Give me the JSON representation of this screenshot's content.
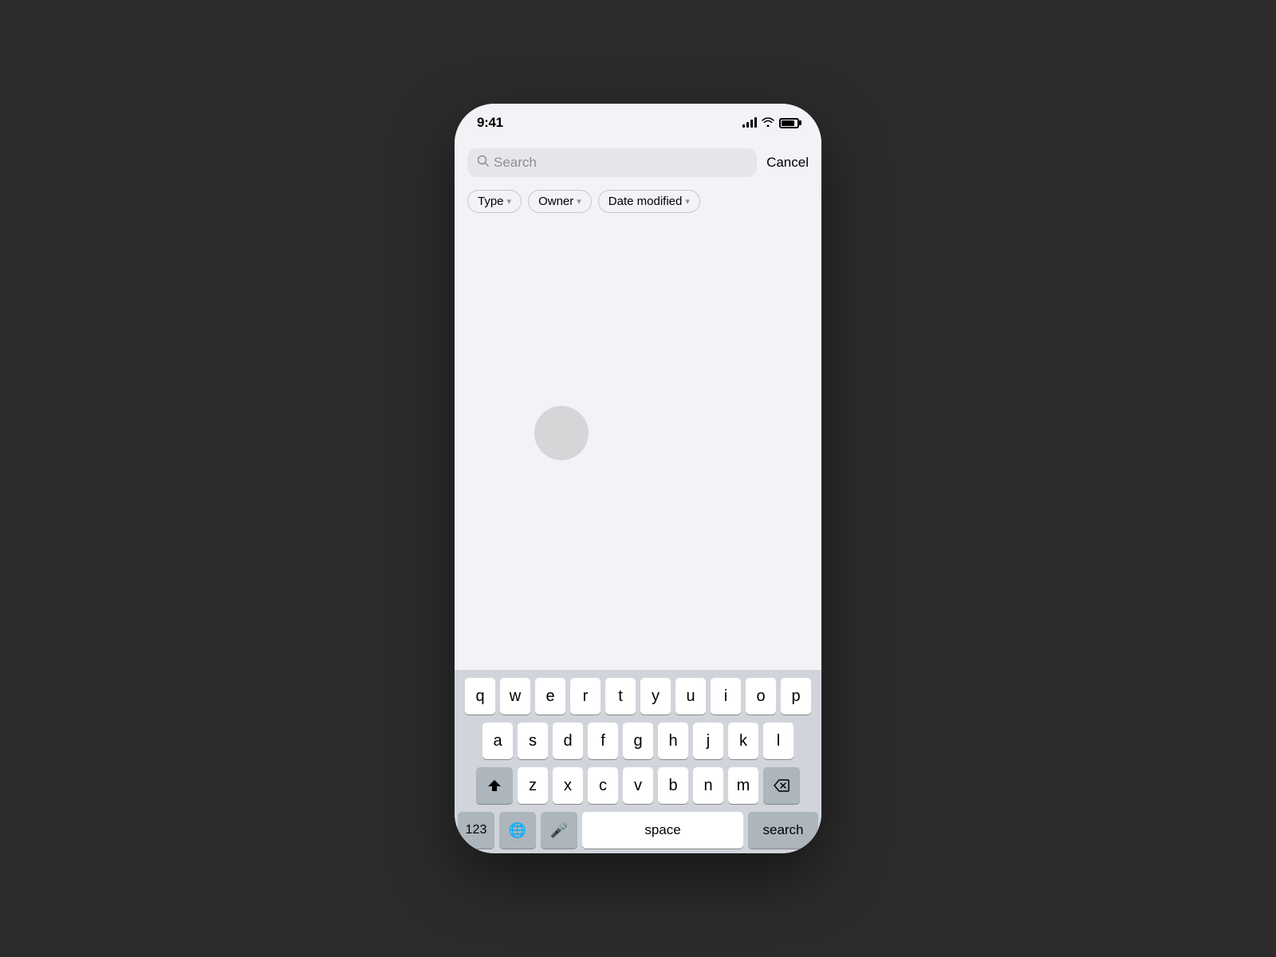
{
  "status_bar": {
    "time": "9:41",
    "signal_label": "signal",
    "wifi_label": "wifi",
    "battery_label": "battery"
  },
  "search_bar": {
    "placeholder": "Search",
    "cancel_label": "Cancel"
  },
  "filters": [
    {
      "label": "Type",
      "has_chevron": true
    },
    {
      "label": "Owner",
      "has_chevron": true
    },
    {
      "label": "Date modified",
      "has_chevron": true
    }
  ],
  "keyboard": {
    "rows": [
      [
        "q",
        "w",
        "e",
        "r",
        "t",
        "y",
        "u",
        "i",
        "o",
        "p"
      ],
      [
        "a",
        "s",
        "d",
        "f",
        "g",
        "h",
        "j",
        "k",
        "l"
      ],
      [
        "shift",
        "z",
        "x",
        "c",
        "v",
        "b",
        "n",
        "m",
        "delete"
      ],
      [
        "123",
        "globe",
        "mic",
        "space",
        "search"
      ]
    ],
    "space_label": "space",
    "search_label": "search",
    "numbers_label": "123"
  }
}
